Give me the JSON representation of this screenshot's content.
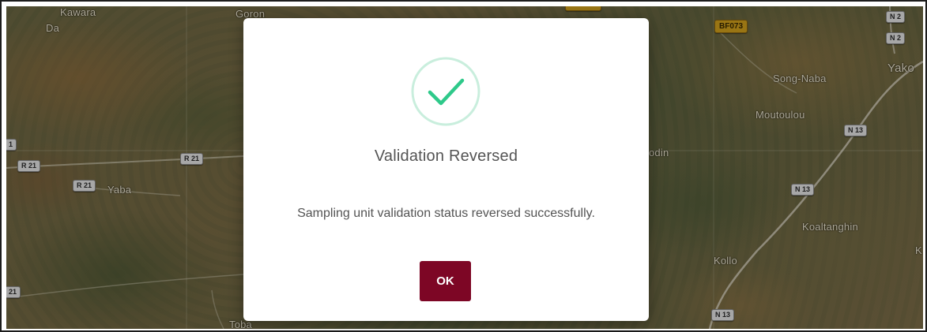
{
  "map": {
    "places": [
      {
        "id": "kawara",
        "text": "Kawara"
      },
      {
        "id": "da",
        "text": "Da"
      },
      {
        "id": "goron",
        "text": "Goron"
      },
      {
        "id": "yaba",
        "text": "Yaba"
      },
      {
        "id": "song-naba",
        "text": "Song-Naba"
      },
      {
        "id": "moutoulou",
        "text": "Moutoulou"
      },
      {
        "id": "yako",
        "text": "Yako"
      },
      {
        "id": "odin",
        "text": "odin"
      },
      {
        "id": "koaltanghin",
        "text": "Koaltanghin"
      },
      {
        "id": "kollo",
        "text": "Kollo"
      },
      {
        "id": "toba",
        "text": "Toba"
      },
      {
        "id": "k-partial",
        "text": "K"
      }
    ],
    "road_labels": [
      {
        "id": "r21-a",
        "text": "R 21"
      },
      {
        "id": "r21-b",
        "text": "R 21"
      },
      {
        "id": "r21-c",
        "text": "R 21"
      },
      {
        "id": "r21-d",
        "text": "21"
      },
      {
        "id": "left-1",
        "text": "1"
      },
      {
        "id": "n2-a",
        "text": "N 2"
      },
      {
        "id": "n2-b",
        "text": "N 2"
      },
      {
        "id": "n13-a",
        "text": "N 13"
      },
      {
        "id": "n13-b",
        "text": "N 13"
      },
      {
        "id": "n13-c",
        "text": "N 13"
      },
      {
        "id": "bf073",
        "text": "BF073"
      }
    ]
  },
  "dialog": {
    "icon": "success-check-icon",
    "title": "Validation Reversed",
    "message": "Sampling unit validation status reversed successfully.",
    "ok_label": "OK",
    "colors": {
      "accent": "#7d0625",
      "check": "#2ec98a",
      "check_ring": "#c9eedd",
      "text": "#545454"
    }
  }
}
